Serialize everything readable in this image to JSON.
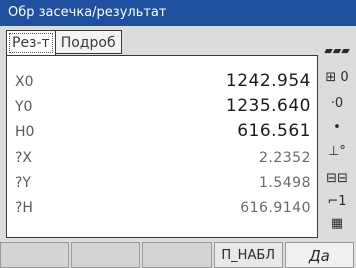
{
  "window": {
    "title": "Обр засечка/результат"
  },
  "tabs": [
    {
      "label": "Рез-т"
    },
    {
      "label": "Подроб"
    }
  ],
  "results": [
    {
      "label": "X0",
      "value": "1242.954"
    },
    {
      "label": "Y0",
      "value": "1235.640"
    },
    {
      "label": "H0",
      "value": "616.561"
    },
    {
      "label": "?X",
      "value": "2.2352"
    },
    {
      "label": "?Y",
      "value": "1.5498"
    },
    {
      "label": "?H",
      "value": "616.9140"
    }
  ],
  "side_icons": [
    {
      "name": "battery-icon",
      "glyph": "▰▰▰"
    },
    {
      "name": "prism-constant-icon",
      "glyph": "⊞ 0"
    },
    {
      "name": "target-icon",
      "glyph": "·0"
    },
    {
      "name": "dot-icon",
      "glyph": "•"
    },
    {
      "name": "tilt-icon",
      "glyph": "⊥°"
    },
    {
      "name": "memory-icon",
      "glyph": "⊟⊟"
    },
    {
      "name": "page-icon",
      "glyph": "⌐1"
    },
    {
      "name": "keyboard-icon",
      "glyph": "▦"
    }
  ],
  "softkeys": [
    {
      "label": ""
    },
    {
      "label": ""
    },
    {
      "label": ""
    },
    {
      "label": "П_НАБЛ"
    },
    {
      "label": "Да"
    }
  ]
}
